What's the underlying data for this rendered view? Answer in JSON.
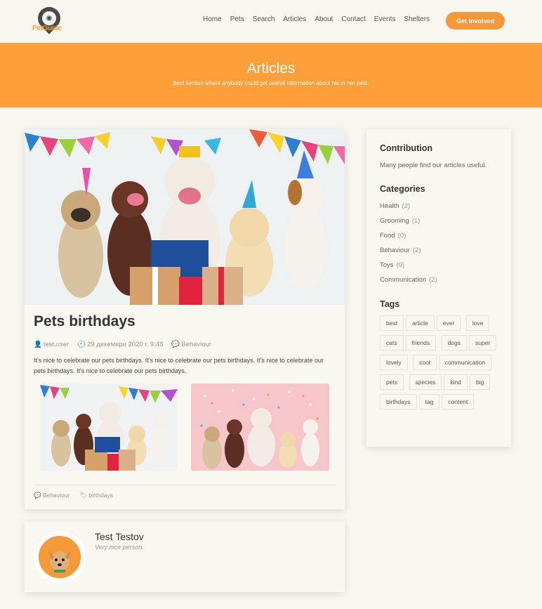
{
  "header": {
    "logo_text": "PetGuide",
    "nav": [
      "Home",
      "Pets",
      "Search",
      "Articles",
      "About",
      "Contact",
      "Events",
      "Shelters"
    ],
    "cta_label": "Get Involved"
  },
  "banner": {
    "title": "Articles",
    "subtitle": "Best section where anybody could get usefull information about his or her pets."
  },
  "article": {
    "title": "Pets birthdays",
    "author": "test.user",
    "date": "29 декември 2020 г. 9:48",
    "category": "Behaviour",
    "body": "It's nice to celebrate our pets birthdays. It's nice to celebrate our pets birthdays. It's nice to celebrate our pets birthdays. It's nice to celebrate our pets birthdays.",
    "footer_category": "Behaviour",
    "footer_tag": "birthdays"
  },
  "author_card": {
    "name": "Test Testov",
    "bio": "Very nice person."
  },
  "sidebar": {
    "contribution_title": "Contribution",
    "contribution_text": "Many people find our articles useful.",
    "categories_title": "Categories",
    "categories": [
      {
        "name": "Health",
        "count": "(2)"
      },
      {
        "name": "Grooming",
        "count": "(1)"
      },
      {
        "name": "Food",
        "count": "(0)"
      },
      {
        "name": "Behaviour",
        "count": "(2)"
      },
      {
        "name": "Toys",
        "count": "(0)"
      },
      {
        "name": "Communication",
        "count": "(2)"
      }
    ],
    "tags_title": "Tags",
    "tags": [
      "best",
      "article",
      "ever",
      "love",
      "cats",
      "friends",
      "dogs",
      "super",
      "lovely",
      "cool",
      "communication",
      "pets",
      "species",
      "kind",
      "big",
      "birthdays",
      "tag",
      "content"
    ]
  },
  "colors": {
    "accent": "#ff9f3a",
    "background": "#f7f6ef"
  }
}
